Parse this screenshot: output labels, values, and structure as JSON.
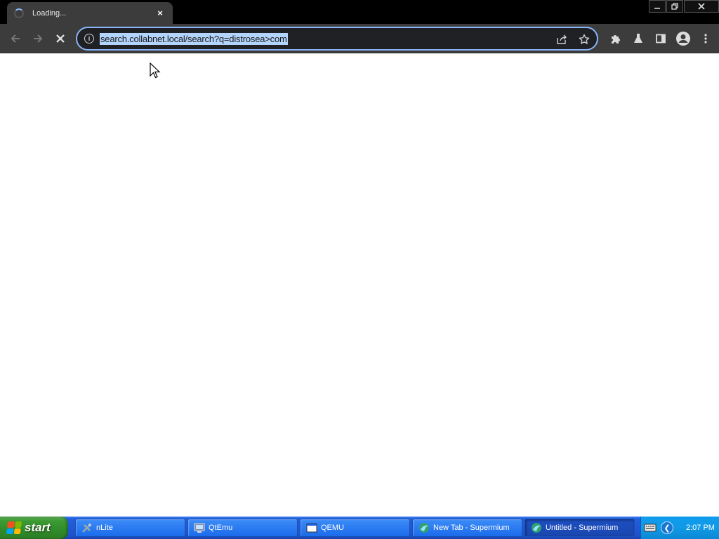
{
  "browser": {
    "tab": {
      "title": "Loading...",
      "close_label": "×"
    },
    "url": "search.collabnet.local/search?q=distrosea>com"
  },
  "taskbar": {
    "start_label": "start",
    "tasks": [
      {
        "label": "nLite"
      },
      {
        "label": "QtEmu"
      },
      {
        "label": "QEMU"
      },
      {
        "label": "New Tab - Supermium"
      },
      {
        "label": "Untitled - Supermium"
      }
    ],
    "clock": "2:07 PM"
  },
  "colors": {
    "accent": "#8ab4f8",
    "url_selection": "#b3d4fc",
    "taskbar_blue": "#245edb",
    "start_green": "#3c9a33"
  },
  "icons": [
    "loading-spinner-icon",
    "close-icon",
    "minimize-icon",
    "restore-icon",
    "back-arrow-icon",
    "forward-arrow-icon",
    "stop-icon",
    "info-icon",
    "share-icon",
    "star-icon",
    "extensions-puzzle-icon",
    "labs-flask-icon",
    "side-panel-icon",
    "profile-avatar-icon",
    "menu-kebab-icon",
    "windows-flag-icon",
    "keyboard-icon",
    "tray-expand-icon"
  ]
}
